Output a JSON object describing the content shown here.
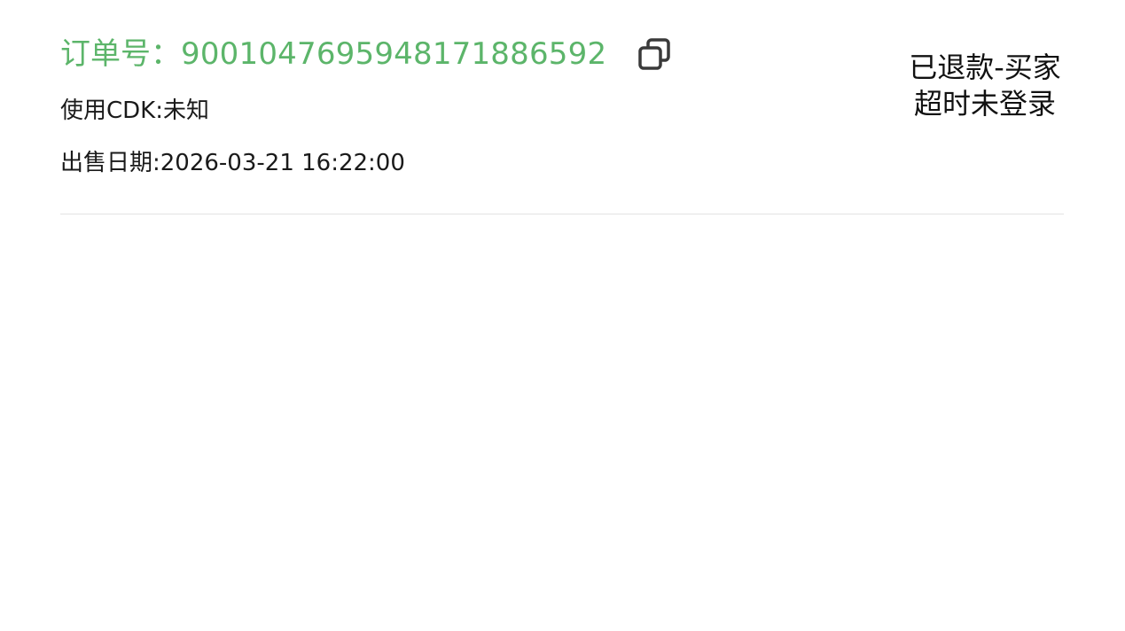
{
  "order": {
    "order_no_label": "订单号：",
    "order_no_value": "9001047695948171886592",
    "copy_icon": "copy-icon",
    "cdk_line": "使用CDK:未知",
    "sale_date_line": "出售日期:2026-03-21 16:22:00",
    "status": "已退款-买家超时未登录"
  },
  "colors": {
    "accent": "#5cb56a",
    "text": "#1a1a1a",
    "icon": "#3a3a3a",
    "divider": "#e3e3e3"
  }
}
